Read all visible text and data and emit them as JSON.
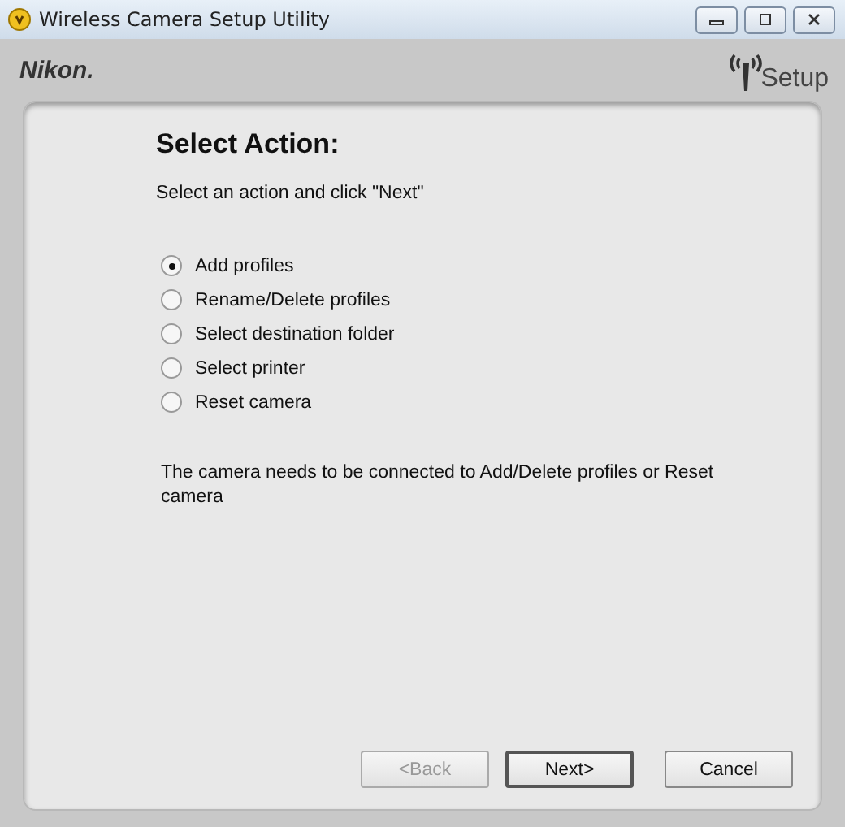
{
  "window": {
    "title": "Wireless Camera Setup Utility"
  },
  "header": {
    "brand": "Nikon.",
    "setup_label": "Setup"
  },
  "heading": "Select Action:",
  "instruction": "Select an action and click \"Next\"",
  "options": [
    {
      "label": "Add profiles",
      "selected": true
    },
    {
      "label": "Rename/Delete profiles",
      "selected": false
    },
    {
      "label": "Select destination folder",
      "selected": false
    },
    {
      "label": "Select printer",
      "selected": false
    },
    {
      "label": "Reset camera",
      "selected": false
    }
  ],
  "note": "The camera needs to be connected to Add/Delete profiles or Reset camera",
  "buttons": [
    {
      "label": "<Back",
      "disabled": true,
      "default": false
    },
    {
      "label": "Next>",
      "disabled": false,
      "default": true
    },
    {
      "label": "Cancel",
      "disabled": false,
      "default": false
    }
  ]
}
